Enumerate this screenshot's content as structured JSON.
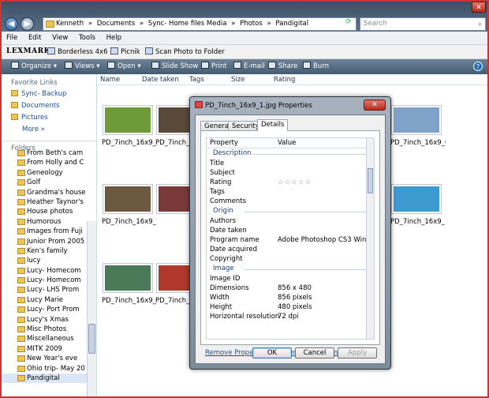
{
  "address": {
    "crumbs": [
      "Kenneth",
      "»",
      "Documents",
      "»",
      "Sync- Home files Media",
      "»",
      "Photos",
      "»",
      "Pandigital"
    ]
  },
  "search": {
    "placeholder": "Search"
  },
  "menu": [
    "File",
    "Edit",
    "View",
    "Tools",
    "Help"
  ],
  "lexmark": {
    "logo": "LEXMARK",
    "items": [
      "Borderless 4x6",
      "Picnik",
      "Scan Photo to Folder"
    ]
  },
  "toolbar": [
    "Organize ▾",
    "Views ▾",
    "Open ▾",
    "Slide Show",
    "Print",
    "E-mail",
    "Share",
    "Burn"
  ],
  "nav": {
    "favorites_header": "Favorite Links",
    "favorites": [
      "Sync- Backup",
      "Documents",
      "Pictures"
    ],
    "more": "More »",
    "folders_header": "Folders",
    "folders": [
      "From Beth's cam",
      "From Holly and C",
      "Geneology",
      "Golf",
      "Grandma's house",
      "Heather Taynor's",
      "House photos",
      "Humorous",
      "Images from Fuji",
      "Junior Prom 2005",
      "Ken's family",
      "lucy",
      "Lucy- Homecom",
      "Lucy- Homecom",
      "Lucy- LHS Prom",
      "Lucy Marie",
      "Lucy- Port Prom",
      "Lucy's Xmas",
      "Misc Photos",
      "Miscellaneous",
      "MITK 2009",
      "New Year's eve",
      "Ohio trip- May 20",
      "Pandigital"
    ],
    "selected_folder": "Pandigital"
  },
  "columns": [
    "Name",
    "Date taken",
    "Tags",
    "Size",
    "Rating"
  ],
  "thumbnails": [
    {
      "label": "PD_7inch_16x9_1....",
      "color": "#6f9a3a"
    },
    {
      "label": "PD_7inch_16x9_...",
      "color": "#5a4a3a"
    },
    {
      "label": "PD_7inch_16x9_6....",
      "color": "#7fa3c8"
    },
    {
      "label": "PD_7inch_16x9_7....",
      "color": "#6b5a40"
    },
    {
      "label": "",
      "color": "#7a3a3a"
    },
    {
      "label": "PD_7inch_16x9_1....",
      "color": "#3c9ad0"
    },
    {
      "label": "PD_7inch_16x9_1....",
      "color": "#4b7a58"
    },
    {
      "label": "PD_7inch_16x9_...",
      "color": "#b0382c"
    }
  ],
  "dialog": {
    "title": "PD_7inch_16x9_1.jpg Properties",
    "tabs": [
      "General",
      "Security",
      "Details"
    ],
    "active_tab": "Details",
    "list_header": {
      "property": "Property",
      "value": "Value"
    },
    "sections": [
      {
        "name": "Description",
        "rows": [
          {
            "p": "Title",
            "v": ""
          },
          {
            "p": "Subject",
            "v": ""
          },
          {
            "p": "Rating",
            "v": "☆☆☆☆☆"
          },
          {
            "p": "Tags",
            "v": ""
          },
          {
            "p": "Comments",
            "v": ""
          }
        ]
      },
      {
        "name": "Origin",
        "rows": [
          {
            "p": "Authors",
            "v": ""
          },
          {
            "p": "Date taken",
            "v": ""
          },
          {
            "p": "Program name",
            "v": "Adobe Photoshop CS3 Win..."
          },
          {
            "p": "Date acquired",
            "v": ""
          },
          {
            "p": "Copyright",
            "v": ""
          }
        ]
      },
      {
        "name": "Image",
        "rows": [
          {
            "p": "Image ID",
            "v": ""
          },
          {
            "p": "Dimensions",
            "v": "856 x 480"
          },
          {
            "p": "Width",
            "v": "856 pixels"
          },
          {
            "p": "Height",
            "v": "480 pixels"
          },
          {
            "p": "Horizontal resolution",
            "v": "72 dpi"
          }
        ]
      }
    ],
    "remove_link": "Remove Properties and Personal Information",
    "buttons": {
      "ok": "OK",
      "cancel": "Cancel",
      "apply": "Apply"
    }
  }
}
